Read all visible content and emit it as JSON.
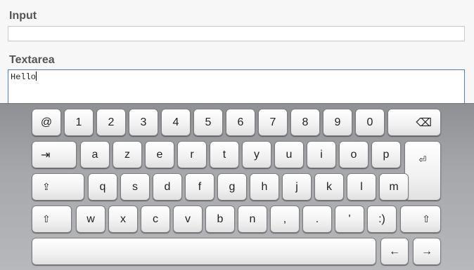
{
  "form": {
    "input_label": "Input",
    "input_value": "",
    "textarea_label": "Textarea",
    "textarea_value": "Hello"
  },
  "keyboard": {
    "row1": [
      "@",
      "1",
      "2",
      "3",
      "4",
      "5",
      "6",
      "7",
      "8",
      "9",
      "0",
      "⌫"
    ],
    "row2": [
      "⇥",
      "a",
      "z",
      "e",
      "r",
      "t",
      "y",
      "u",
      "i",
      "o",
      "p",
      "⏎"
    ],
    "row3": [
      "⇪",
      "q",
      "s",
      "d",
      "f",
      "g",
      "h",
      "j",
      "k",
      "l",
      "m"
    ],
    "row4": [
      "⇧",
      "w",
      "x",
      "c",
      "v",
      "b",
      "n",
      ",",
      ".",
      "'",
      ":)",
      "⇧"
    ],
    "row5": [
      "",
      "←",
      "→"
    ]
  }
}
